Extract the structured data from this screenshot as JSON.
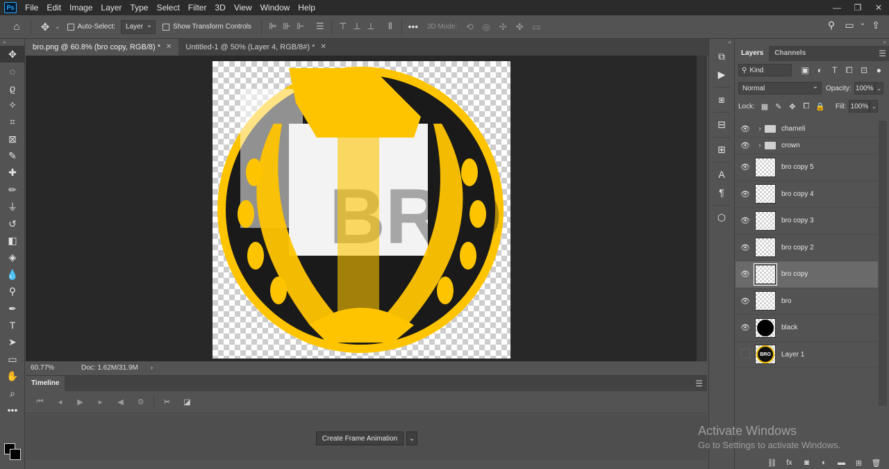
{
  "menu": [
    "File",
    "Edit",
    "Image",
    "Layer",
    "Type",
    "Select",
    "Filter",
    "3D",
    "View",
    "Window",
    "Help"
  ],
  "app_logo": "Ps",
  "window_controls": [
    "minimize-icon",
    "restore-icon",
    "close-icon"
  ],
  "options": {
    "auto_select_label": "Auto-Select:",
    "auto_select_value": "Layer",
    "transform_controls_label": "Show Transform Controls",
    "mode3d_label": "3D Mode:"
  },
  "tabs": [
    {
      "label": "bro.png @ 60.8% (bro copy, RGB/8) *",
      "active": true
    },
    {
      "label": "Untitled-1 @ 50% (Layer 4, RGB/8#) *",
      "active": false
    }
  ],
  "status": {
    "zoom": "60.77%",
    "doc": "Doc: 1.62M/31.9M",
    "arrow": "›"
  },
  "timeline": {
    "tab": "Timeline",
    "create_button": "Create Frame Animation"
  },
  "layers_panel": {
    "tabs": [
      "Layers",
      "Channels"
    ],
    "kind_label": "Kind",
    "blend_mode": "Normal",
    "opacity_label": "Opacity:",
    "opacity_value": "100%",
    "lock_label": "Lock:",
    "fill_label": "Fill:",
    "fill_value": "100%",
    "layers": [
      {
        "name": "chameli",
        "type": "group",
        "visible": true
      },
      {
        "name": "crown",
        "type": "group",
        "visible": true
      },
      {
        "name": "bro copy 5",
        "type": "layer",
        "visible": true
      },
      {
        "name": "bro copy 4",
        "type": "layer",
        "visible": true
      },
      {
        "name": "bro copy 3",
        "type": "layer",
        "visible": true
      },
      {
        "name": "bro copy 2",
        "type": "layer",
        "visible": true
      },
      {
        "name": "bro copy",
        "type": "layer",
        "visible": true,
        "selected": true
      },
      {
        "name": "bro",
        "type": "layer",
        "visible": true
      },
      {
        "name": "black",
        "type": "layer",
        "visible": true,
        "thumb": "black-circle"
      },
      {
        "name": "Layer 1",
        "type": "layer",
        "visible": false,
        "thumb": "logo",
        "thumb_text": "BRO"
      }
    ]
  },
  "canvas_art": {
    "text": "BRO",
    "colors": {
      "gold": "#FFC400",
      "black": "#1A1A1A",
      "white": "#FFFFFF"
    }
  },
  "watermark": {
    "title": "Activate Windows",
    "subtitle": "Go to Settings to activate Windows."
  }
}
